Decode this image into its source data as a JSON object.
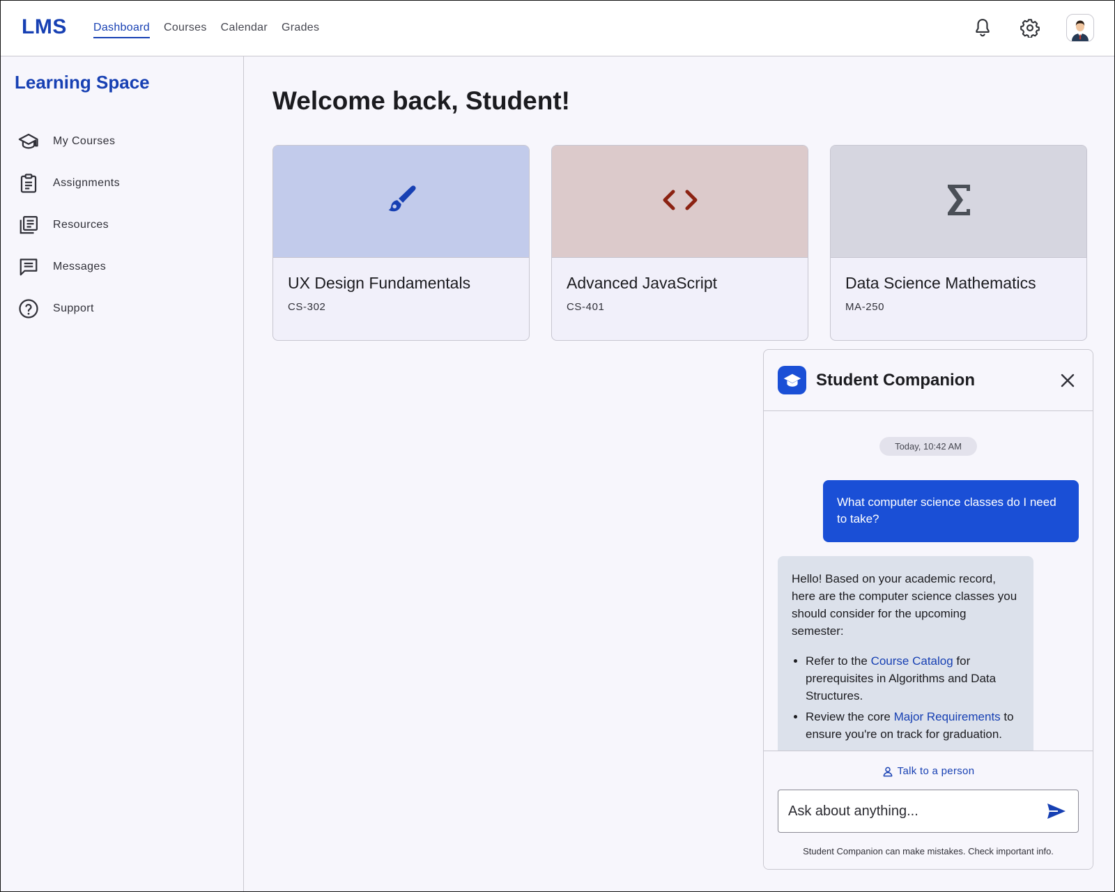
{
  "app": {
    "logo": "LMS"
  },
  "topnav": {
    "items": [
      {
        "label": "Dashboard",
        "active": true
      },
      {
        "label": "Courses",
        "active": false
      },
      {
        "label": "Calendar",
        "active": false
      },
      {
        "label": "Grades",
        "active": false
      }
    ],
    "icons": [
      "bell-icon",
      "gear-icon",
      "user-avatar"
    ]
  },
  "sidebar": {
    "title": "Learning Space",
    "items": [
      {
        "label": "My Courses",
        "icon": "graduation-cap-icon"
      },
      {
        "label": "Assignments",
        "icon": "clipboard-icon"
      },
      {
        "label": "Resources",
        "icon": "library-icon"
      },
      {
        "label": "Messages",
        "icon": "chat-icon"
      },
      {
        "label": "Support",
        "icon": "help-circle-icon"
      }
    ]
  },
  "main": {
    "welcome": "Welcome back, Student!",
    "courses": [
      {
        "title": "UX Design Fundamentals",
        "code": "CS-302",
        "icon": "brush-icon",
        "banner_color": "#c2cbeb",
        "icon_color": "#1740b3"
      },
      {
        "title": "Advanced JavaScript",
        "code": "CS-401",
        "icon": "code-icon",
        "banner_color": "#dccacb",
        "icon_color": "#8b2212"
      },
      {
        "title": "Data Science Mathematics",
        "code": "MA-250",
        "icon": "sigma-icon",
        "banner_color": "#d6d6e0",
        "icon_color": "#4a4f57"
      }
    ]
  },
  "chat": {
    "title": "Student Companion",
    "timestamp": "Today, 10:42 AM",
    "user_message": "What computer science classes do I need to take?",
    "bot_intro": "Hello! Based on your academic record, here are the computer science classes you should consider for the upcoming semester:",
    "bot_items": [
      {
        "before": "Refer to the ",
        "link": "Course Catalog",
        "after": " for prerequisites in Algorithms and Data Structures."
      },
      {
        "before": "Review the core ",
        "link": "Major Requirements",
        "after": " to ensure you're on track for graduation."
      }
    ],
    "talk_to_person": "Talk to a person",
    "input_placeholder": "Ask about anything...",
    "disclaimer": "Student Companion can make mistakes. Check important info."
  },
  "colors": {
    "accent": "#1740b3",
    "chat_primary": "#1a4fd6",
    "bot_bubble": "#dce1eb"
  }
}
